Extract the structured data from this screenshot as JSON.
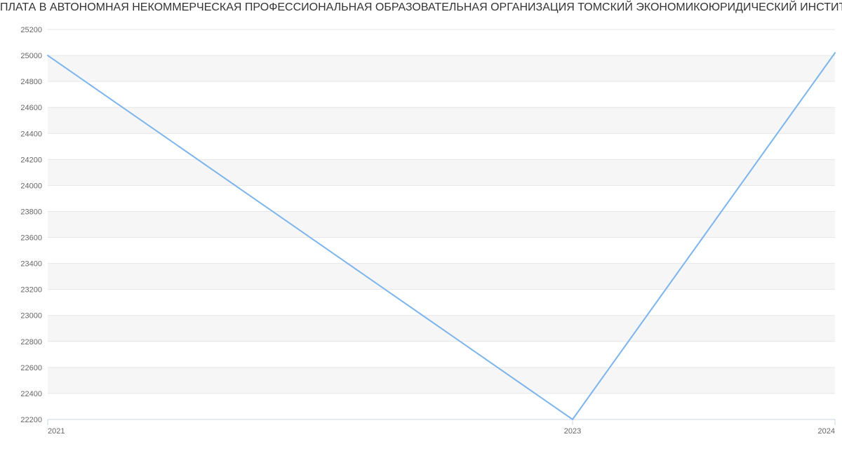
{
  "chart_data": {
    "type": "line",
    "title": "ПЛАТА В АВТОНОМНАЯ НЕКОММЕРЧЕСКАЯ ПРОФЕССИОНАЛЬНАЯ ОБРАЗОВАТЕЛЬНАЯ ОРГАНИЗАЦИЯ ТОМСКИЙ ЭКОНОМИКОЮРИДИЧЕСКИЙ ИНСТИТУТ | Данные mnogo.w",
    "x": [
      2021,
      2023,
      2024
    ],
    "y": [
      25000,
      22200,
      25020
    ],
    "x_ticks": [
      2021,
      2023,
      2024
    ],
    "y_ticks": [
      22200,
      22400,
      22600,
      22800,
      23000,
      23200,
      23400,
      23600,
      23800,
      24000,
      24200,
      24400,
      24600,
      24800,
      25000,
      25200
    ],
    "xlabel": "",
    "ylabel": "",
    "ylim": [
      22200,
      25200
    ],
    "xlim": [
      2021,
      2024
    ],
    "line_color": "#7cb5ec",
    "grid": true
  },
  "colors": {
    "grid_band": "#f6f6f6",
    "grid_line": "#e6e6e6",
    "axis": "#ccd6eb",
    "tick_text": "#666666"
  }
}
